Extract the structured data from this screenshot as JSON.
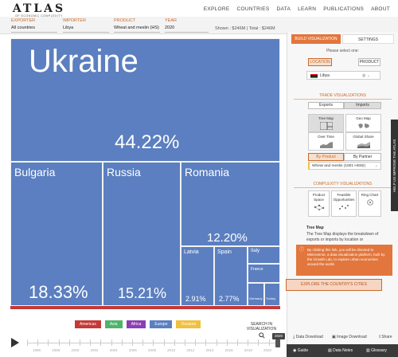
{
  "header": {
    "logo_main": "ATLAS",
    "logo_sub": "OF ECONOMIC COMPLEXITY",
    "nav": [
      "EXPLORE",
      "COUNTRIES",
      "DATA",
      "LEARN",
      "PUBLICATIONS",
      "ABOUT"
    ]
  },
  "selectors": {
    "exporter_label": "EXPORTER",
    "exporter_value": "All countries",
    "importer_label": "IMPORTER",
    "importer_value": "Libya",
    "product_label": "PRODUCT",
    "product_value": "Wheat and meslin (HS)",
    "year_label": "YEAR",
    "year_value": "2020",
    "shown_text": "Shown : $246M | Total : $246M"
  },
  "treemap": {
    "cells": [
      {
        "name": "Ukraine",
        "pct": "44.22%",
        "value": 44.22,
        "color": "#5b7fc0"
      },
      {
        "name": "Bulgaria",
        "pct": "18.33%",
        "value": 18.33,
        "color": "#5b7fc0"
      },
      {
        "name": "Russia",
        "pct": "15.21%",
        "value": 15.21,
        "color": "#5b7fc0"
      },
      {
        "name": "Romania",
        "pct": "12.20%",
        "value": 12.2,
        "color": "#5b7fc0"
      },
      {
        "name": "Latvia",
        "pct": "2.91%",
        "value": 2.91,
        "color": "#5b7fc0"
      },
      {
        "name": "Spain",
        "pct": "2.77%",
        "value": 2.77,
        "color": "#5b7fc0"
      },
      {
        "name": "Italy",
        "pct": "",
        "value": null,
        "color": "#5b7fc0"
      },
      {
        "name": "France",
        "pct": "",
        "value": null,
        "color": "#5b7fc0"
      },
      {
        "name": "Germany",
        "pct": "",
        "value": null,
        "color": "#5b7fc0"
      },
      {
        "name": "Turkey",
        "pct": "",
        "value": null,
        "color": "#5b7fc0"
      }
    ]
  },
  "legend": [
    {
      "label": "Americas",
      "color": "#c33a38"
    },
    {
      "label": "Asia",
      "color": "#4fb36b"
    },
    {
      "label": "Africa",
      "color": "#8b3fb3"
    },
    {
      "label": "Europe",
      "color": "#5b7fc0"
    },
    {
      "label": "Oceania",
      "color": "#f0c040"
    }
  ],
  "search_viz": "SEARCH IN VISUALIZATION",
  "timeline": {
    "years": [
      "1996",
      "1998",
      "2000",
      "2002",
      "2004",
      "2006",
      "2008",
      "2010",
      "2012",
      "2014",
      "2016",
      "2018",
      "2020"
    ],
    "current": "2020"
  },
  "panel": {
    "tab_build": "BUILD VISUALIZATION",
    "tab_settings": "SETTINGS",
    "select_one": "Please select one:",
    "location_btn": "LOCATION",
    "product_btn": "PRODUCT",
    "location_value": "Libya",
    "trade_title": "TRADE VISUALIZATIONS",
    "exports": "Exports",
    "imports": "Imports",
    "viz": [
      "Tree Map",
      "Geo Map",
      "Over Time",
      "Global Share"
    ],
    "by_product": "By Product",
    "by_partner": "By Partner",
    "product_select": "Wheat and meslin (1001 HS92)",
    "complexity_title": "COMPLEXITY VISUALIZATIONS",
    "complexity": [
      "Product Space",
      "Feasible Opportunities",
      "Ring Chart"
    ],
    "treemap_title": "Tree Map",
    "treemap_desc": "The Tree Map displays the breakdown of exports or imports by location or",
    "tooltip": "By clicking this link, you will be directed to Metroverse, a data visualization platform, built by the Growth Lab, to explore urban economies around the world.",
    "cities_btn": "EXPLORE THE COUNTRY'S CITIES",
    "feedback": "HELP US IMPROVE THE ATLAS",
    "data_download": "Data Download",
    "image_download": "Image Download",
    "share": "Share",
    "guide": "Guide",
    "data_notes": "Data Notes",
    "glossary": "Glossary"
  }
}
